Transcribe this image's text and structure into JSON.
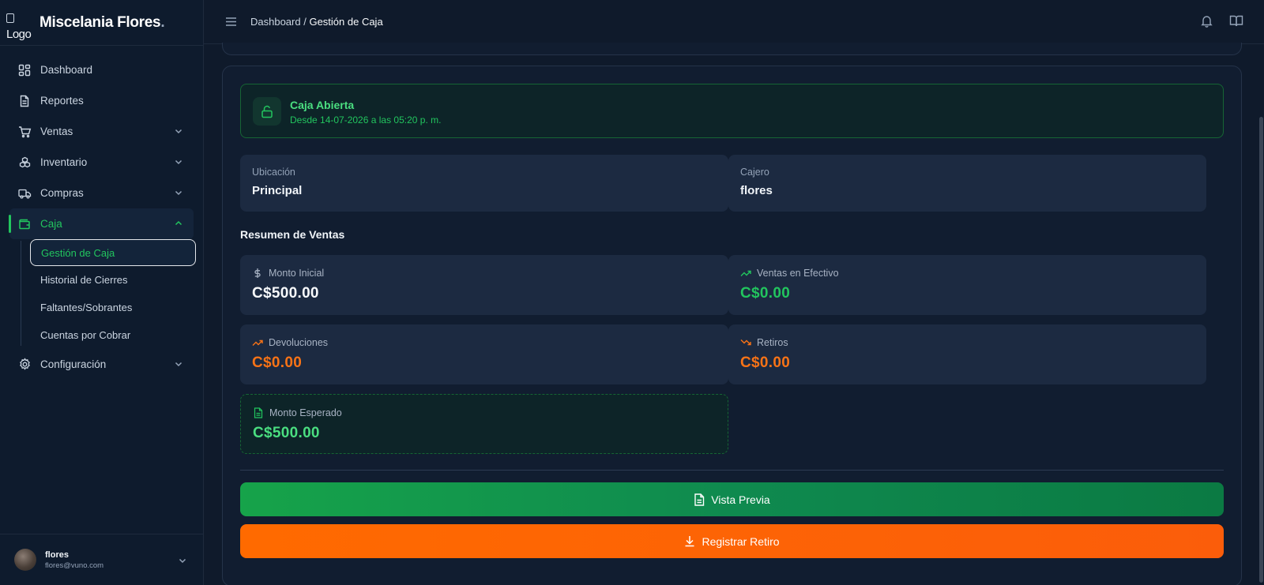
{
  "sidebar": {
    "logo_text": "Logo",
    "brand": "Miscelania Flores",
    "brand_dot": ".",
    "items": [
      {
        "label": "Dashboard",
        "icon": "grid-icon"
      },
      {
        "label": "Reportes",
        "icon": "document-icon"
      },
      {
        "label": "Ventas",
        "icon": "cart-icon"
      },
      {
        "label": "Inventario",
        "icon": "boxes-icon"
      },
      {
        "label": "Compras",
        "icon": "truck-icon"
      },
      {
        "label": "Caja",
        "icon": "wallet-icon"
      },
      {
        "label": "Configuración",
        "icon": "gear-icon"
      }
    ],
    "caja_sub": [
      {
        "label": "Gestión de Caja"
      },
      {
        "label": "Historial de Cierres"
      },
      {
        "label": "Faltantes/Sobrantes"
      },
      {
        "label": "Cuentas por Cobrar"
      }
    ],
    "user": {
      "name": "flores",
      "email": "flores@vuno.com"
    }
  },
  "topbar": {
    "crumb_parent": "Dashboard",
    "crumb_sep": " / ",
    "crumb_current": "Gestión de Caja"
  },
  "status": {
    "title": "Caja Abierta",
    "subtitle": "Desde 14-07-2026 a las 05:20 p. m."
  },
  "info": {
    "location_label": "Ubicación",
    "location_value": "Principal",
    "cashier_label": "Cajero",
    "cashier_value": "flores"
  },
  "summary": {
    "title": "Resumen de Ventas",
    "initial_label": "Monto Inicial",
    "initial_value": "C$500.00",
    "cash_sales_label": "Ventas en Efectivo",
    "cash_sales_value": "C$0.00",
    "returns_label": "Devoluciones",
    "returns_value": "C$0.00",
    "withdrawals_label": "Retiros",
    "withdrawals_value": "C$0.00",
    "expected_label": "Monto Esperado",
    "expected_value": "C$500.00"
  },
  "actions": {
    "preview": "Vista Previa",
    "withdraw": "Registrar Retiro"
  },
  "colors": {
    "accent_green": "#22c55e",
    "accent_orange": "#f97316",
    "background": "#0f1a2b"
  }
}
